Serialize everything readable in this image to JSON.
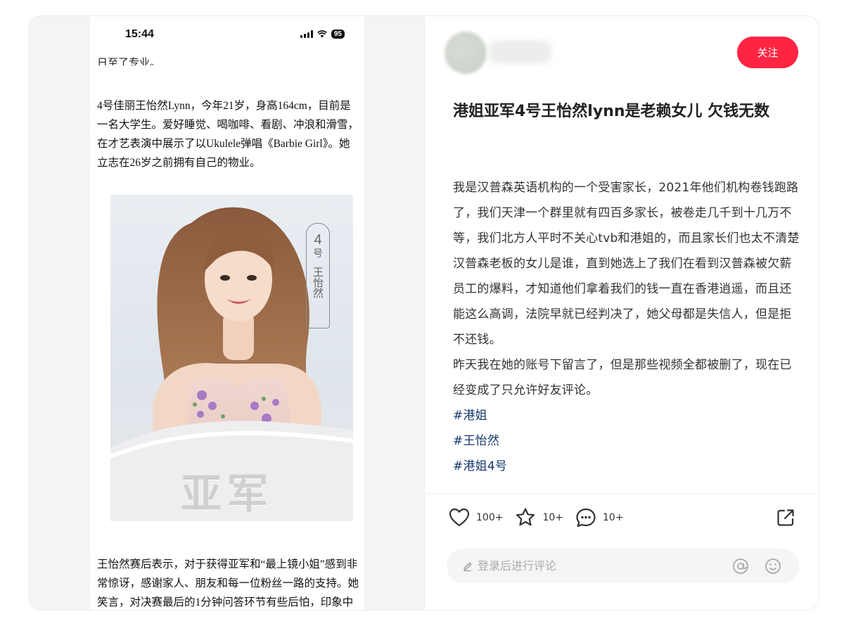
{
  "screenshot": {
    "status_time": "15:44",
    "battery": "95",
    "top_cut_text": "日至了专业。",
    "paragraph_1": "4号佳丽王怡然Lynn，今年21岁，身高164cm，目前是一名大学生。爱好睡觉、喝咖啡、看剧、冲浪和滑雪，在才艺表演中展示了以Ukulele弹唱《Barbie Girl》。她立志在26岁之前拥有自己的物业。",
    "photo_number": "4",
    "photo_hao": "号",
    "photo_name": "王怡然",
    "photo_title": "亚军",
    "paragraph_2": "王怡然赛后表示，对于获得亚军和“最上镜小姐”感到非常惊讶，感谢家人、朋友和每一位粉丝一路的支持。她笑言，对决赛最后的1分钟问答环节有些后怕，印象中非常深刻。虽然之前广东话"
  },
  "post": {
    "follow_label": "关注",
    "title": "港姐亚军4号王怡然lynn是老赖女儿 欠钱无数",
    "body_1": "我是汉普森英语机构的一个受害家长，2021年他们机构卷钱跑路了，我们天津一个群里就有四百多家长，被卷走几千到十几万不等，我们北方人平时不关心tvb和港姐的，而且家长们也太不清楚汉普森老板的女儿是谁，直到她选上了我们在看到汉普森被欠薪员工的爆料，才知道他们拿着我们的钱一直在香港逍遥，而且还能这么高调，法院早就已经判决了，她父母都是失信人，但是拒不还钱。",
    "body_2": "昨天我在她的账号下留言了，但是那些视频全都被删了，现在已经变成了只允许好友评论。",
    "tags": [
      "#港姐",
      "#王怡然",
      "#港姐4号"
    ]
  },
  "engagement": {
    "likes": "100+",
    "collects": "10+",
    "comments": "10+"
  },
  "comment_box": {
    "placeholder": "登录后进行评论"
  },
  "colors": {
    "accent": "#ff2442",
    "tag": "#13386c"
  }
}
